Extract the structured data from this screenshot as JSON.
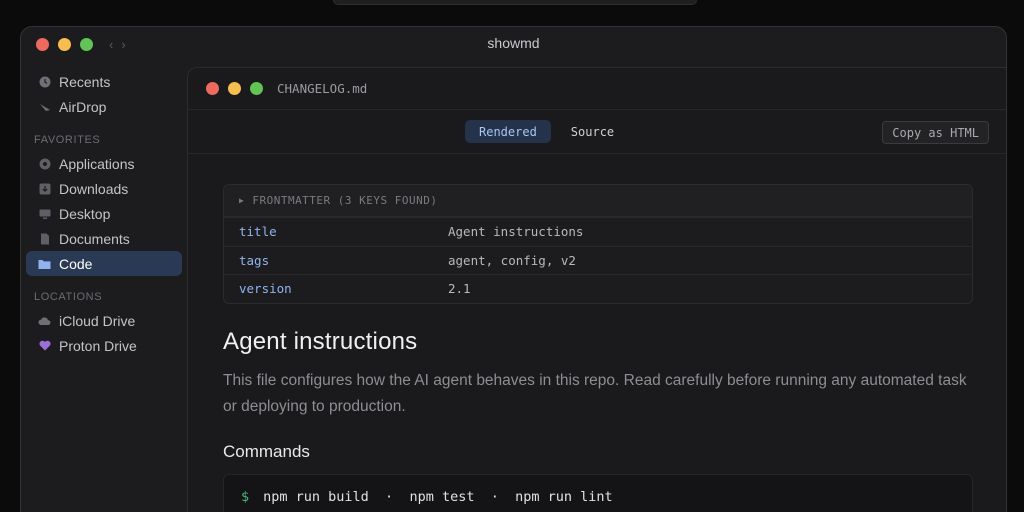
{
  "finder": {
    "title": "showmd",
    "nav_back": "‹",
    "nav_forward": "›",
    "sidebar": {
      "top_items": [
        {
          "label": "Recents",
          "icon": "clock-icon"
        },
        {
          "label": "AirDrop",
          "icon": "airdrop-icon"
        }
      ],
      "favorites_header": "FAVORITES",
      "favorites": [
        {
          "label": "Applications",
          "icon": "applications-icon"
        },
        {
          "label": "Downloads",
          "icon": "downloads-icon"
        },
        {
          "label": "Desktop",
          "icon": "desktop-icon"
        },
        {
          "label": "Documents",
          "icon": "documents-icon"
        },
        {
          "label": "Code",
          "icon": "folder-icon",
          "active": true
        }
      ],
      "locations_header": "LOCATIONS",
      "locations": [
        {
          "label": "iCloud Drive",
          "icon": "cloud-icon"
        },
        {
          "label": "Proton Drive",
          "icon": "heart-icon"
        }
      ]
    }
  },
  "document": {
    "filename": "CHANGELOG.md",
    "tabs": {
      "rendered": "Rendered",
      "source": "Source"
    },
    "active_tab": "rendered",
    "copy_button": "Copy as HTML",
    "frontmatter": {
      "header": "FRONTMATTER (3 KEYS FOUND)",
      "rows": [
        {
          "key": "title",
          "value": "Agent instructions"
        },
        {
          "key": "tags",
          "value": "agent, config, v2"
        },
        {
          "key": "version",
          "value": "2.1"
        }
      ]
    },
    "heading": "Agent instructions",
    "paragraph": "This file configures how the AI agent behaves in this repo. Read carefully before running any automated task or deploying to production.",
    "subheading": "Commands",
    "code": {
      "prompt": "$",
      "command": "npm run build  ·  npm test  ·  npm run lint"
    }
  },
  "colors": {
    "accent": "#8fb4f0",
    "active_sidebar": "#2b3a54",
    "prompt": "#4fb37a"
  }
}
